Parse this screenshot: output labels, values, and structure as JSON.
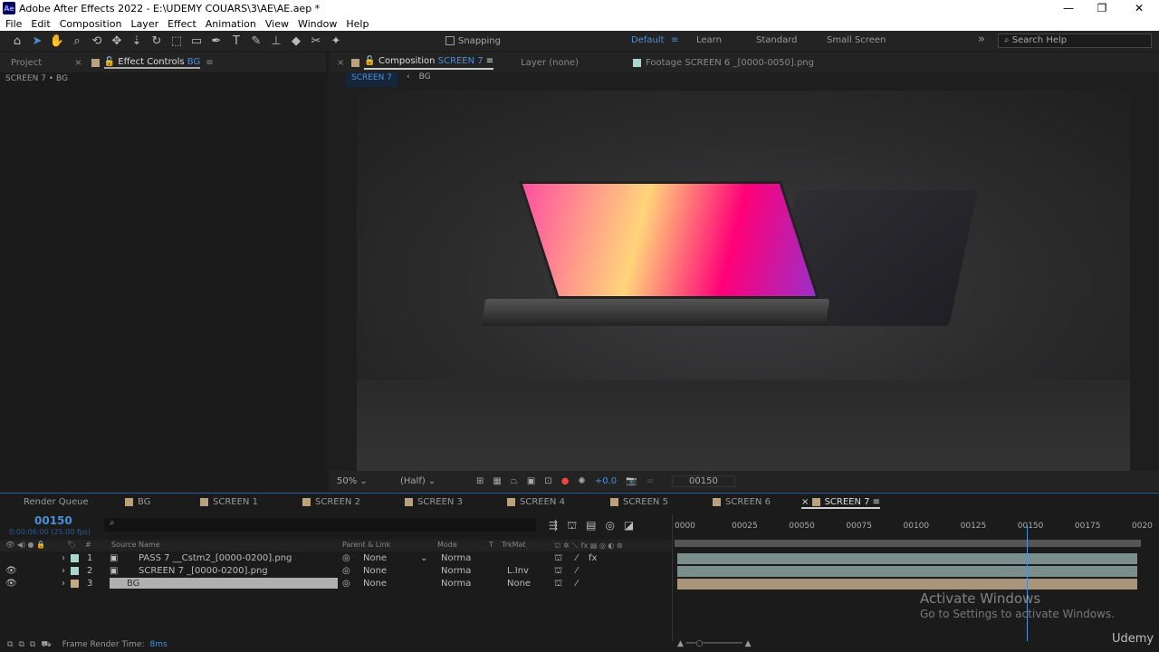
{
  "window": {
    "title": "Adobe After Effects 2022 - E:\\UDEMY COUARS\\3\\AE\\AE.aep *",
    "logo": "Ae",
    "minimize": "—",
    "restore": "❐",
    "close": "✕"
  },
  "menu": [
    "File",
    "Edit",
    "Composition",
    "Layer",
    "Effect",
    "Animation",
    "View",
    "Window",
    "Help"
  ],
  "toolbar": {
    "snapping": "Snapping",
    "workspaces": [
      "Default",
      "Learn",
      "Standard",
      "Small Screen"
    ],
    "active_workspace": "Default",
    "search_placeholder": "Search Help",
    "expand": "»"
  },
  "left_panel": {
    "tabs": [
      "Project",
      "Effect Controls"
    ],
    "effect_target": "BG",
    "subtitle": "SCREEN 7 • BG"
  },
  "viewer": {
    "comp_label": "Composition",
    "comp_name": "SCREEN 7",
    "layer_tab": "Layer (none)",
    "footage_tab": "Footage SCREEN 6 _[0000-0050].png",
    "breadcrumbs": [
      "SCREEN 7",
      "BG"
    ],
    "zoom": "50%",
    "resolution": "(Half)",
    "exposure": "+0.0",
    "timecode": "00150"
  },
  "timeline": {
    "tabs": [
      "Render Queue",
      "BG",
      "SCREEN 1",
      "SCREEN 2",
      "SCREEN 3",
      "SCREEN 4",
      "SCREEN 5",
      "SCREEN 6",
      "SCREEN 7"
    ],
    "active_tab": "SCREEN 7",
    "current_frame": "00150",
    "timecode_sub": "0:00:06:00 (25.00 fps)",
    "search_icon": "⌕",
    "columns": {
      "source_name": "Source Name",
      "parent": "Parent & Link",
      "mode": "Mode",
      "t": "T",
      "trkmat": "TrkMat",
      "num": "#"
    },
    "layers": [
      {
        "num": "1",
        "name": "PASS 7 __Cstm2_[0000-0200].png",
        "parent": "None",
        "mode": "Norma",
        "trkmat": "",
        "color": "#a9d6cf",
        "visible": false,
        "fx": "fx"
      },
      {
        "num": "2",
        "name": "SCREEN 7 _[0000-0200].png",
        "parent": "None",
        "mode": "Norma",
        "trkmat": "L.Inv",
        "color": "#a9d6cf",
        "visible": true,
        "fx": ""
      },
      {
        "num": "3",
        "name": "BG",
        "parent": "None",
        "mode": "Norma",
        "trkmat": "None",
        "color": "#c4a987",
        "visible": true,
        "fx": ""
      }
    ],
    "ruler": [
      "0000",
      "00025",
      "00050",
      "00075",
      "00100",
      "00125",
      "00150",
      "00175",
      "0020"
    ],
    "playhead_frame": 150,
    "frame_render_label": "Frame Render Time:",
    "frame_render_value": "8ms"
  },
  "watermark": {
    "line1": "Activate Windows",
    "line2": "Go to Settings to activate Windows.",
    "brand": "Udemy"
  }
}
